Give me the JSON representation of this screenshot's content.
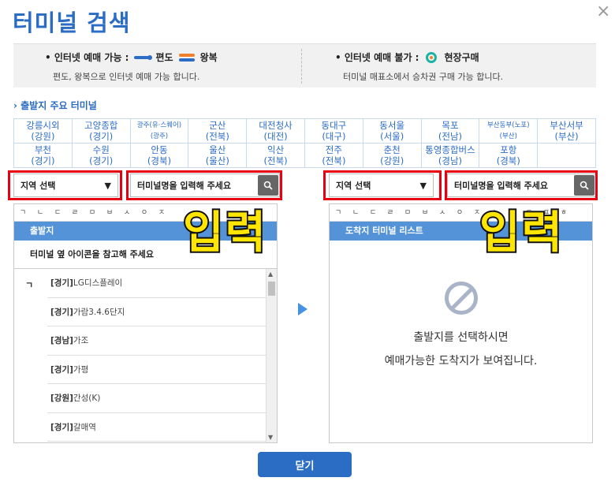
{
  "header": {
    "title": "터미널 검색",
    "close_glyph": "×"
  },
  "info": {
    "online_title": "• 인터넷 예매 가능 :",
    "oneway_label": "편도",
    "roundtrip_label": "왕복",
    "online_desc": "편도, 왕복으로 인터넷 예매 가능 합니다.",
    "offline_title": "• 인터넷 예매 불가 :",
    "onsite_label": "현장구매",
    "offline_desc": "터미널 매표소에서 승차권 구매 가능 합니다."
  },
  "section": {
    "title": "출발지 주요 터미널"
  },
  "terminals": [
    [
      "강릉시외",
      "(강원)"
    ],
    [
      "고양종합",
      "(경기)"
    ],
    [
      "광주(유·스퀘어)",
      "(광주)"
    ],
    [
      "군산",
      "(전북)"
    ],
    [
      "대전청사",
      "(대전)"
    ],
    [
      "동대구",
      "(대구)"
    ],
    [
      "동서울",
      "(서울)"
    ],
    [
      "목포",
      "(전남)"
    ],
    [
      "부산동부(노포)",
      "(부산)"
    ],
    [
      "부산서부",
      "(부산)"
    ],
    [
      "부천",
      "(경기)"
    ],
    [
      "수원",
      "(경기)"
    ],
    [
      "안동",
      "(경북)"
    ],
    [
      "울산",
      "(울산)"
    ],
    [
      "익산",
      "(전북)"
    ],
    [
      "전주",
      "(전북)"
    ],
    [
      "춘천",
      "(강원)"
    ],
    [
      "통영종합버스",
      "(경남)"
    ],
    [
      "포항",
      "(경북)"
    ]
  ],
  "left": {
    "region_label": "지역 선택",
    "search_placeholder": "터미널명을 입력해 주세요",
    "consonants": [
      "ㄱ",
      "ㄴ",
      "ㄷ",
      "ㄹ",
      "ㅁ",
      "ㅂ",
      "ㅅ",
      "ㅇ",
      "ㅈ"
    ],
    "panel_title": "출발지",
    "notice": "터미널 옆 아이콘을 참고해 주세요",
    "letter": "ㄱ",
    "items": [
      {
        "region": "[경기]",
        "name": "LG디스플레이"
      },
      {
        "region": "[경기]",
        "name": "가람3.4.6단지"
      },
      {
        "region": "[경남]",
        "name": "가조"
      },
      {
        "region": "[경기]",
        "name": "가평"
      },
      {
        "region": "[강원]",
        "name": "간성(K)"
      },
      {
        "region": "[경기]",
        "name": "갈매역"
      }
    ],
    "overlay": "입력"
  },
  "right": {
    "region_label": "지역 선택",
    "search_placeholder": "터미널명을 입력해 주세요",
    "consonants": [
      "ㄱ",
      "ㄴ",
      "ㄷ",
      "ㄹ",
      "ㅁ",
      "ㅂ",
      "ㅅ",
      "ㅇ",
      "ㅈ",
      "ㅊ",
      "ㅋ",
      "ㅌ",
      "ㅍ",
      "ㅎ"
    ],
    "panel_title": "도착지 터미널 리스트",
    "empty_msg1": "출발지를 선택하시면",
    "empty_msg2": "예매가능한 도착지가 보여집니다.",
    "overlay": "입력"
  },
  "footer": {
    "close_label": "닫기"
  },
  "colors": {
    "accent": "#2b6cc4",
    "highlight": "#e60012",
    "panel_header": "#5593d9"
  }
}
